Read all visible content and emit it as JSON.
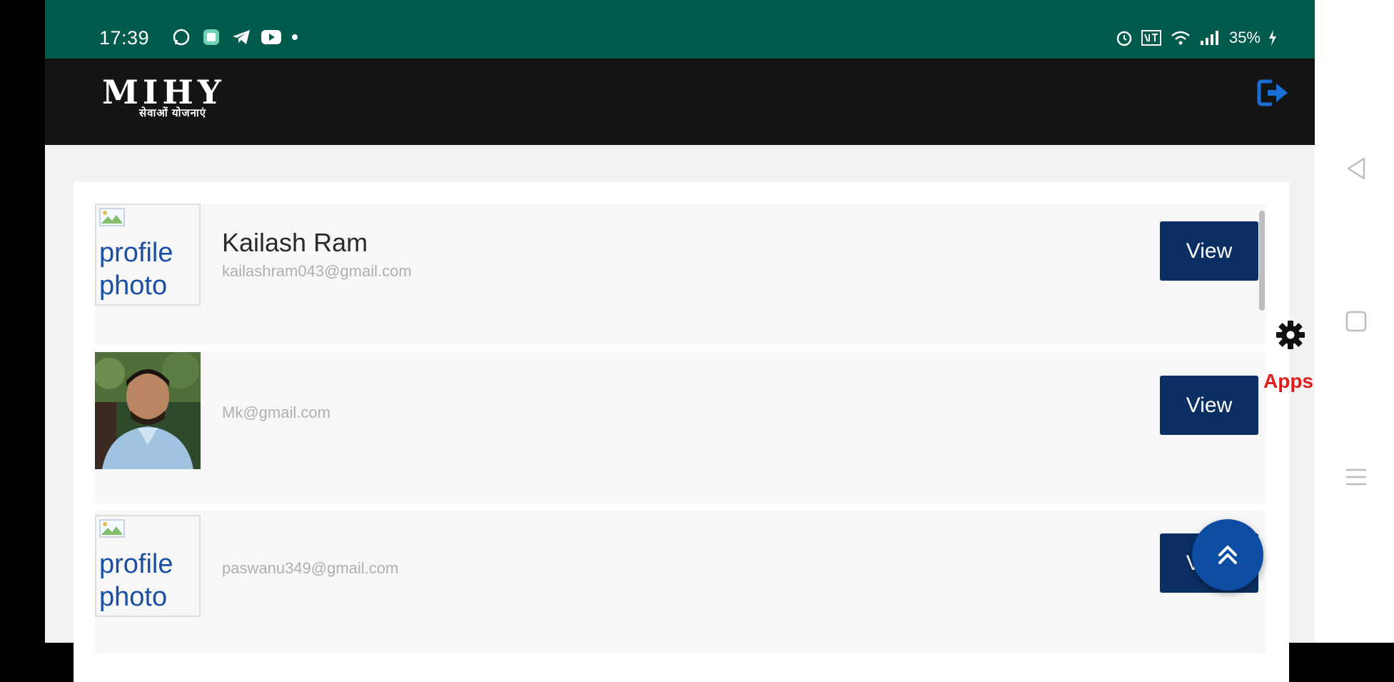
{
  "status_bar": {
    "time": "17:39",
    "battery": "35%",
    "left_icons": [
      "whatsapp-icon",
      "app-notification-icon",
      "telegram-icon",
      "youtube-icon",
      "dot-icon"
    ],
    "right_icons": [
      "alarm-icon",
      "volte-icon",
      "wifi-icon",
      "signal-icon",
      "charging-icon"
    ]
  },
  "header": {
    "logo_text": "MIHY",
    "logo_subtitle": "सेवाओं योजनाएं",
    "logout_icon": "logout-icon"
  },
  "users": [
    {
      "name": "Kailash Ram",
      "email": "kailashram043@gmail.com",
      "avatar_alt": "profile photo",
      "has_photo": false,
      "view_label": "View"
    },
    {
      "name": "",
      "email": "Mk@gmail.com",
      "avatar_alt": "",
      "has_photo": true,
      "view_label": "View"
    },
    {
      "name": "",
      "email": "paswanu349@gmail.com",
      "avatar_alt": "profile photo",
      "has_photo": false,
      "view_label": "View"
    }
  ],
  "floating": {
    "apps_label": "Apps",
    "gear_icon": "gear-icon",
    "fab_icon": "double-chevron-up-icon"
  },
  "nav": {
    "back_icon": "back-icon",
    "home_icon": "home-icon",
    "recents_icon": "recents-icon"
  },
  "colors": {
    "status_bar": "#005b4c",
    "top_bar": "#141414",
    "button": "#0b2f63",
    "fab": "#0d4da3",
    "apps_label": "#e31b1b"
  }
}
